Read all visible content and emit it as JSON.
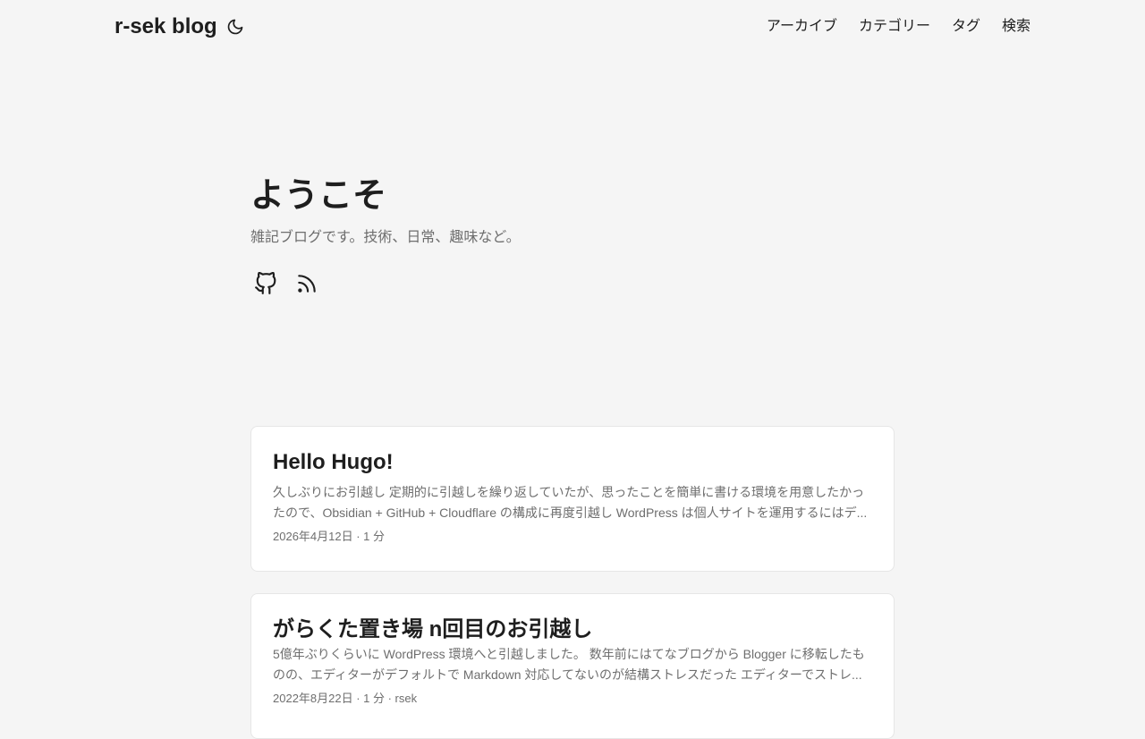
{
  "header": {
    "logo": "r-sek blog",
    "theme_icon": "moon-icon",
    "nav": [
      {
        "label": "アーカイブ"
      },
      {
        "label": "カテゴリー"
      },
      {
        "label": "タグ"
      },
      {
        "label": "検索"
      }
    ]
  },
  "home": {
    "title": "ようこそ",
    "description": "雑記ブログです。技術、日常、趣味など。",
    "social": [
      {
        "icon": "github-icon"
      },
      {
        "icon": "rss-icon"
      }
    ]
  },
  "posts": [
    {
      "title": "Hello Hugo!",
      "summary": "久しぶりにお引越し 定期的に引越しを繰り返していたが、思ったことを簡単に書ける環境を用意したかったので、Obsidian + GitHub + Cloudflare の構成に再度引越し WordPress は個人サイトを運用するにはデ...",
      "meta": "2026年4月12日 · 1 分"
    },
    {
      "title": "がらくた置き場 n回目のお引越し",
      "summary": "5億年ぶりくらいに WordPress 環境へと引越しました。 数年前にはてなブログから Blogger に移転したものの、エディターがデフォルトで Markdown 対応してないのが結構ストレスだった エディターでストレ...",
      "meta": "2022年8月22日 · 1 分 · rsek"
    }
  ]
}
